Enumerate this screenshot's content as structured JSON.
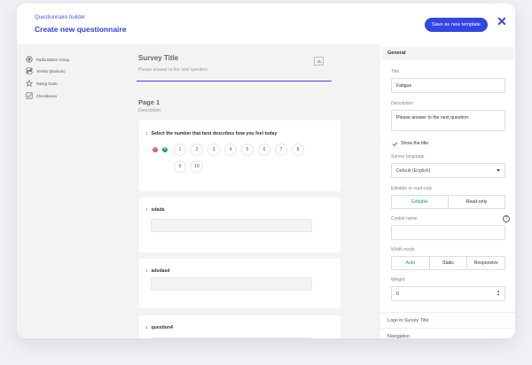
{
  "header": {
    "subtitle": "Questionnaire builder",
    "title": "Create new questionnaire",
    "save_label": "Save as new template",
    "close_glyph": "✕"
  },
  "toolbox": {
    "items": [
      {
        "label": "Radio Button Group",
        "icon": "radio-group-icon"
      },
      {
        "label": "Yes/No (Boolean)",
        "icon": "boolean-toggle-icon"
      },
      {
        "label": "Rating Scale",
        "icon": "star-icon"
      },
      {
        "label": "Checkboxes",
        "icon": "checkbox-icon"
      }
    ]
  },
  "survey": {
    "title": "Survey Title",
    "description": "Please answer to the next question:",
    "page_title": "Page 1",
    "page_description": "Description"
  },
  "questions": [
    {
      "number": "1.",
      "title": "Select the number that best describes how you feel today",
      "rating": [
        "1",
        "2",
        "3",
        "4",
        "5",
        "6",
        "7",
        "8",
        "9",
        "10"
      ]
    },
    {
      "number": "2.",
      "title": "sdada"
    },
    {
      "number": "3.",
      "title": "adsdasd"
    },
    {
      "number": "4.",
      "title": "question4"
    }
  ],
  "properties": {
    "section_general": "General",
    "title_label": "Title",
    "title_value": "Fatigue",
    "description_label": "Description",
    "description_value": "Please answer to the next question:",
    "show_title_label": "Show the title",
    "language_label": "Survey language",
    "language_value": "Default (English)",
    "edit_label": "Editable or read-only",
    "edit_options": [
      "Editable",
      "Read-only"
    ],
    "cookie_label": "Cookie name",
    "width_label": "Width mode",
    "width_options": [
      "Auto",
      "Static",
      "Responsive"
    ],
    "weight_label": "Weight",
    "weight_value": "0",
    "section_logo": "Logo in Survey Title",
    "section_navigation": "Navigation"
  },
  "colors": {
    "accent": "#3445e5",
    "active_green": "#17a37a"
  }
}
